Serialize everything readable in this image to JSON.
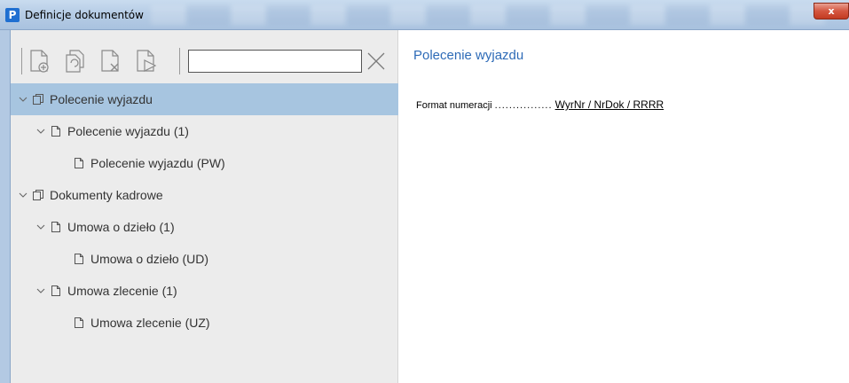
{
  "window": {
    "title": "Definicje dokumentów",
    "app_icon_letter": "P",
    "close_label": "x"
  },
  "toolbar": {
    "buttons": [
      "add-document-icon",
      "copy-document-icon",
      "delete-document-icon",
      "export-document-icon"
    ],
    "search_value": "",
    "search_placeholder": ""
  },
  "tree": {
    "items": [
      {
        "label": "Polecenie wyjazdu",
        "level": 0,
        "kind": "group",
        "expanded": true,
        "selected": true
      },
      {
        "label": "Polecenie wyjazdu (1)",
        "level": 1,
        "kind": "doc",
        "expanded": true,
        "selected": false
      },
      {
        "label": "Polecenie wyjazdu (PW)",
        "level": 2,
        "kind": "doc",
        "expanded": false,
        "selected": false
      },
      {
        "label": "Dokumenty kadrowe",
        "level": 0,
        "kind": "group",
        "expanded": true,
        "selected": false
      },
      {
        "label": "Umowa o dzieło (1)",
        "level": 1,
        "kind": "doc",
        "expanded": true,
        "selected": false
      },
      {
        "label": "Umowa o dzieło (UD)",
        "level": 2,
        "kind": "doc",
        "expanded": false,
        "selected": false
      },
      {
        "label": "Umowa zlecenie (1)",
        "level": 1,
        "kind": "doc",
        "expanded": true,
        "selected": false
      },
      {
        "label": "Umowa zlecenie (UZ)",
        "level": 2,
        "kind": "doc",
        "expanded": false,
        "selected": false
      }
    ]
  },
  "details": {
    "title": "Polecenie wyjazdu",
    "field_label": "Format numeracji",
    "field_dots": "................",
    "field_value": "WyrNr / NrDok / RRRR"
  },
  "colors": {
    "selected_row": "#a7c5e0",
    "accent_title": "#2e6bb7"
  }
}
